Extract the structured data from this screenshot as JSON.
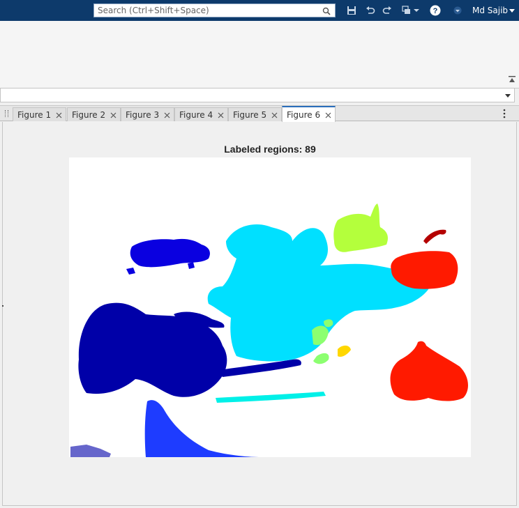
{
  "search": {
    "placeholder": "Search (Ctrl+Shift+Space)"
  },
  "user": {
    "name": "Md Sajib"
  },
  "tabs": [
    {
      "label": "Figure 1"
    },
    {
      "label": "Figure 2"
    },
    {
      "label": "Figure 3"
    },
    {
      "label": "Figure 4"
    },
    {
      "label": "Figure 5"
    },
    {
      "label": "Figure 6"
    }
  ],
  "active_tab": "Figure 6",
  "figure": {
    "title": "Labeled regions: 89",
    "colormap": "jet",
    "region_colors": [
      "#0000a8",
      "#0a00e0",
      "#1e3cff",
      "#00e0ff",
      "#00f0e8",
      "#b4ff3c",
      "#8cff70",
      "#ffd700",
      "#ff1a00",
      "#b40000"
    ]
  },
  "colors": {
    "titlebar": "#0d3a6b",
    "active_tab_accent": "#2a6ebb"
  }
}
